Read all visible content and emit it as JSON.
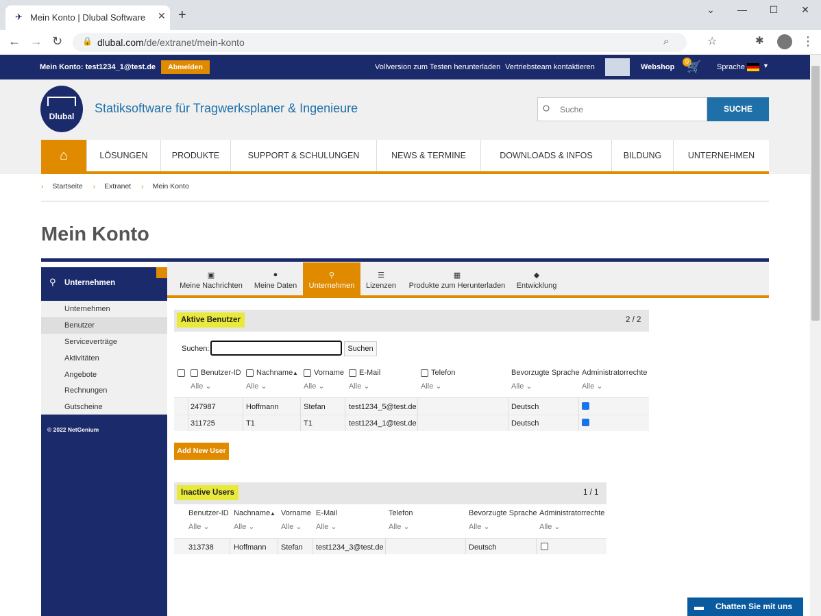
{
  "browser": {
    "tab_title": "Mein Konto | Dlubal Software",
    "url_domain": "dlubal.com",
    "url_path": "/de/extranet/mein-konto"
  },
  "topbar": {
    "account": "Mein Konto: test1234_1@test.de",
    "logout": "Abmelden",
    "trial": "Vollversion zum Testen herunterladen",
    "sales": "Vertriebsteam kontaktieren",
    "webshop": "Webshop",
    "cart_count": "0",
    "language": "Sprache"
  },
  "header": {
    "logo_text": "Dlubal",
    "slogan": "Statiksoftware für Tragwerksplaner & Ingenieure",
    "search_placeholder": "Suche",
    "search_button": "SUCHE"
  },
  "mainnav": [
    "LÖSUNGEN",
    "PRODUKTE",
    "SUPPORT & SCHULUNGEN",
    "NEWS & TERMINE",
    "DOWNLOADS & INFOS",
    "BILDUNG",
    "UNTERNEHMEN"
  ],
  "breadcrumb": [
    "Startseite",
    "Extranet",
    "Mein Konto"
  ],
  "page_title": "Mein Konto",
  "sidebar": {
    "heading": "Unternehmen",
    "items": [
      "Unternehmen",
      "Benutzer",
      "Serviceverträge",
      "Aktivitäten",
      "Angebote",
      "Rechnungen",
      "Gutscheine"
    ],
    "copyright": "© 2022 NetGenium"
  },
  "tabs": [
    "Meine Nachrichten",
    "Meine Daten",
    "Unternehmen",
    "Lizenzen",
    "Produkte zum Herunterladen",
    "Entwicklung"
  ],
  "active": {
    "title": "Aktive Benutzer",
    "pager": "2 / 2",
    "search_label": "Suchen:",
    "search_value": "",
    "search_button": "Suchen",
    "columns": [
      "Benutzer-ID",
      "Nachname",
      "Vorname",
      "E-Mail",
      "Telefon",
      "Bevorzugte Sprache",
      "Administratorrechte"
    ],
    "filter": "Alle",
    "rows": [
      [
        "247987",
        "Hoffmann",
        "Stefan",
        "test1234_5@test.de",
        "",
        "Deutsch"
      ],
      [
        "311725",
        "T1",
        "T1",
        "test1234_1@test.de",
        "",
        "Deutsch"
      ]
    ],
    "add_button": "Add New User"
  },
  "inactive": {
    "title": "Inactive Users",
    "pager": "1 / 1",
    "columns": [
      "Benutzer-ID",
      "Nachname",
      "Vorname",
      "E-Mail",
      "Telefon",
      "Bevorzugte Sprache",
      "Administratorrechte"
    ],
    "filter": "Alle",
    "rows": [
      [
        "313738",
        "Hoffmann",
        "Stefan",
        "test1234_3@test.de",
        "",
        "Deutsch"
      ]
    ]
  },
  "chat": "Chatten Sie mit uns",
  "colors": {
    "navy": "#1b2a6b",
    "orange": "#e08a00",
    "blue": "#1f6fa8"
  }
}
